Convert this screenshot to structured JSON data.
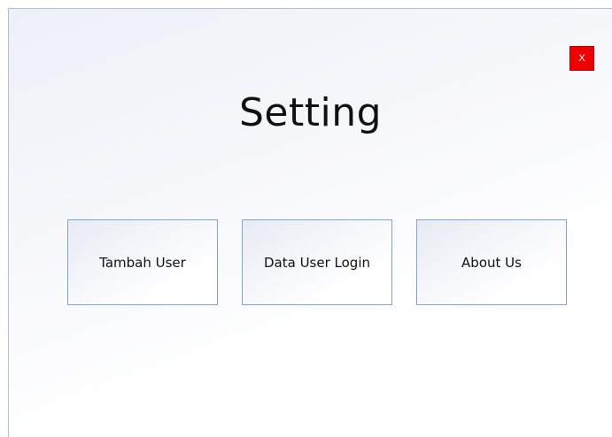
{
  "window": {
    "title": "Setting",
    "close_label": "X"
  },
  "menu": {
    "tiles": [
      {
        "label": "Tambah User"
      },
      {
        "label": "Data User Login"
      },
      {
        "label": "About Us"
      }
    ]
  },
  "colors": {
    "close_button": "#ee0000",
    "tile_border": "#7ea7c9",
    "window_border": "#a9c1d8"
  }
}
